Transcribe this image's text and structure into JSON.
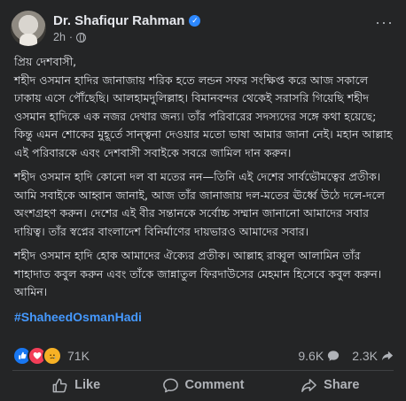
{
  "post": {
    "author": "Dr. Shafiqur Rahman",
    "time": "2h",
    "dot": "·",
    "more": "···",
    "paragraphs": [
      "প্রিয় দেশবাসী,\nশহীদ ওসমান হাদির জানাজায় শরিক হতে লন্ডন সফর সংক্ষিপ্ত করে আজ সকালে ঢাকায় এসে পৌঁছেছি। আলহামদুলিল্লাহ। বিমানবন্দর থেকেই সরাসরি গিয়েছি শহীদ ওসমান হাদিকে এক নজর দেখার জন্য। তাঁর পরিবারের সদস্যদের সঙ্গে কথা হয়েছে; কিন্তু এমন শোকের মুহূর্তে সান্ত্বনা দেওয়ার মতো ভাষা আমার জানা নেই। মহান আল্লাহ এই পরিবারকে এবং দেশবাসী সবাইকে সবরে জামিল দান করুন।",
      "শহীদ ওসমান হাদি কোনো দল বা মতের নন—তিনি এই দেশের সার্বভৌমত্বের প্রতীক। আমি সবাইকে আহ্বান জানাই, আজ তাঁর জানাজায় দল-মতের ঊর্ধ্বে উঠে দলে-দলে অংশগ্রহণ করুন। দেশের এই বীর সন্তানকে সর্বোচ্চ সম্মান জানানো আমাদের সবার দায়িত্ব। তাঁর স্বপ্নের বাংলাদেশ বিনির্মাণের দায়ভারও আমাদের সবার।",
      "শহীদ ওসমান হাদি হোক আমাদের ঐক্যের প্রতীক। আল্লাহ রাব্বুল আলামিন তাঁর শাহাদাত কবুল করুন এবং তাঁকে জান্নাতুল ফিরদাউসের মেহমান হিসেবে কবুল করুন। আমিন।"
    ],
    "hashtag": "#ShaheedOsmanHadi"
  },
  "stats": {
    "reactions": "71K",
    "comments": "9.6K",
    "shares": "2.3K"
  },
  "actions": {
    "like": "Like",
    "comment": "Comment",
    "share": "Share"
  },
  "colors": {
    "background": "#242526",
    "text": "#e4e6eb",
    "secondary": "#b0b3b8",
    "hashtag": "#4599ff",
    "verified": "#2d88ff"
  },
  "icons": [
    "globe-icon",
    "verified-icon",
    "more-icon",
    "like-reaction-icon",
    "love-reaction-icon",
    "sad-reaction-icon",
    "comment-icon",
    "share-icon",
    "thumbs-up-icon"
  ]
}
